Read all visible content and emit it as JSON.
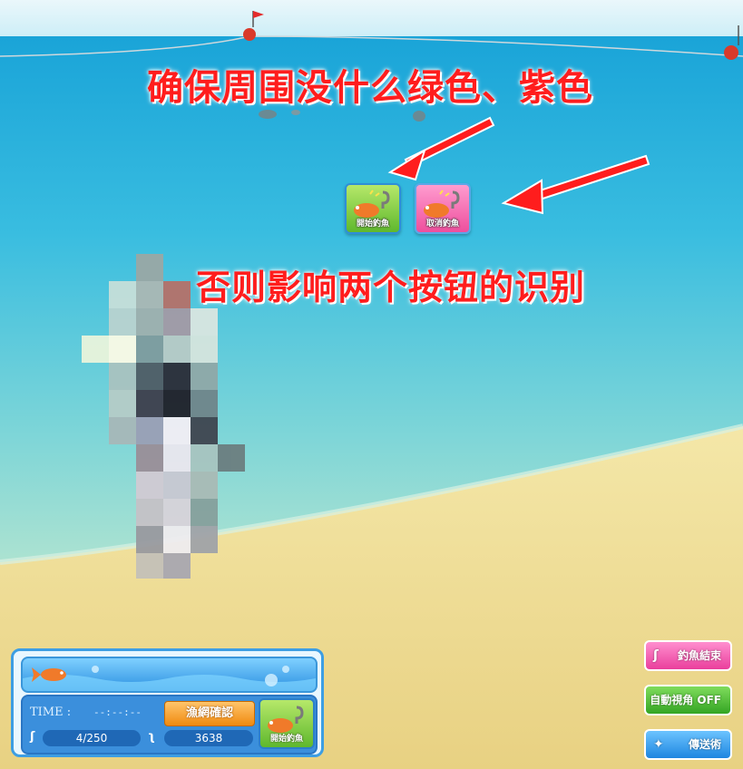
{
  "annotations": {
    "top_note": "确保周围没什么绿色、紫色",
    "middle_note": "否则影响两个按钮的识别"
  },
  "fishing_popup": {
    "start_label": "開始釣魚",
    "cancel_label": "取消釣魚"
  },
  "status_panel": {
    "time_label": "TIME :",
    "time_value": "--:--:--",
    "net_check_label": "漁網確認",
    "bait_count": "4/250",
    "fish_points": "3638",
    "start_label": "開始釣魚"
  },
  "side_buttons": {
    "end_fishing_label": "釣魚結束",
    "auto_view_label": "自動視角 OFF",
    "teleport_label": "傳送術"
  },
  "colors": {
    "annotation": "#ff1d1d",
    "start_green": "#5fb82d",
    "cancel_pink": "#ee4f9d",
    "panel_blue": "#3b8fdc"
  }
}
